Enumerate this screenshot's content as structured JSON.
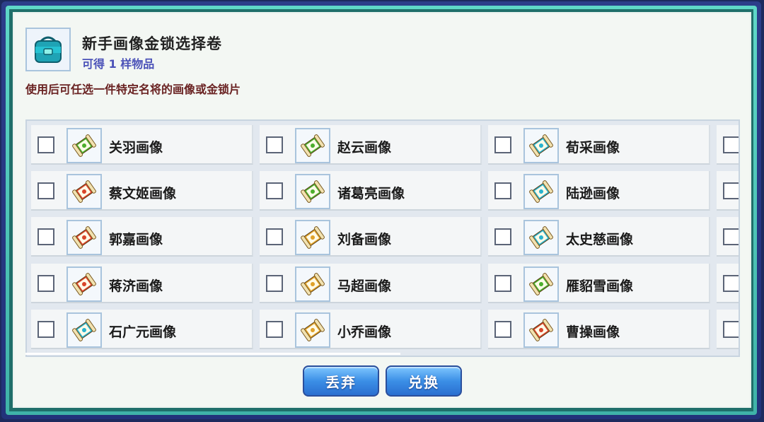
{
  "dialog": {
    "title": "新手画像金锁选择卷",
    "subtitle": "可得 1 样物品",
    "description": "使用后可任选一件特定名将的画像或金锁片"
  },
  "colors": {
    "green": "#4caf2e",
    "red": "#d9442a",
    "teal": "#29b3cf",
    "gold": "#e0a22a"
  },
  "items": [
    {
      "name": "关羽画像",
      "color": "green"
    },
    {
      "name": "赵云画像",
      "color": "green"
    },
    {
      "name": "荀采画像",
      "color": "teal"
    },
    {
      "name": "蔡文姬画像",
      "color": "red"
    },
    {
      "name": "诸葛亮画像",
      "color": "green"
    },
    {
      "name": "陆逊画像",
      "color": "teal"
    },
    {
      "name": "郭嘉画像",
      "color": "red"
    },
    {
      "name": "刘备画像",
      "color": "gold"
    },
    {
      "name": "太史慈画像",
      "color": "teal"
    },
    {
      "name": "蒋济画像",
      "color": "red"
    },
    {
      "name": "马超画像",
      "color": "gold"
    },
    {
      "name": "雁貂雪画像",
      "color": "green"
    },
    {
      "name": "石广元画像",
      "color": "teal"
    },
    {
      "name": "小乔画像",
      "color": "gold"
    },
    {
      "name": "曹操画像",
      "color": "red"
    }
  ],
  "buttons": {
    "discard": "丢弃",
    "exchange": "兑换"
  }
}
